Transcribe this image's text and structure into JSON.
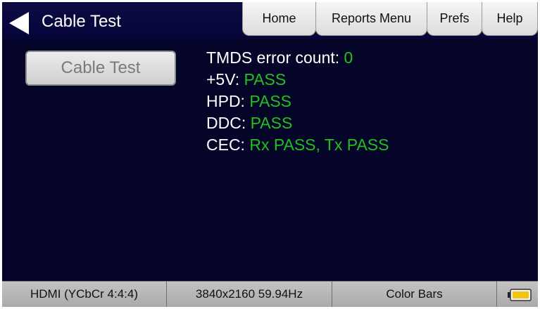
{
  "header": {
    "title": "Cable Test",
    "tabs": [
      {
        "label": "Home"
      },
      {
        "label": "Reports Menu"
      },
      {
        "label": "Prefs"
      },
      {
        "label": "Help"
      }
    ]
  },
  "main": {
    "cable_test_button": "Cable Test",
    "results": [
      {
        "label": "TMDS error count: ",
        "value": "0"
      },
      {
        "label": "+5V: ",
        "value": "PASS"
      },
      {
        "label": "HPD: ",
        "value": "PASS"
      },
      {
        "label": "DDC: ",
        "value": "PASS"
      },
      {
        "label": "CEC: ",
        "value": "Rx PASS, Tx PASS"
      }
    ]
  },
  "statusbar": {
    "interface": "HDMI (YCbCr 4:4:4)",
    "timing": "3840x2160 59.94Hz",
    "pattern": "Color Bars"
  },
  "icons": {
    "back": "back-arrow-icon",
    "battery": "battery-icon"
  },
  "colors": {
    "background": "#05052a",
    "pass_green": "#22c01d",
    "label_white": "#ffffff"
  }
}
